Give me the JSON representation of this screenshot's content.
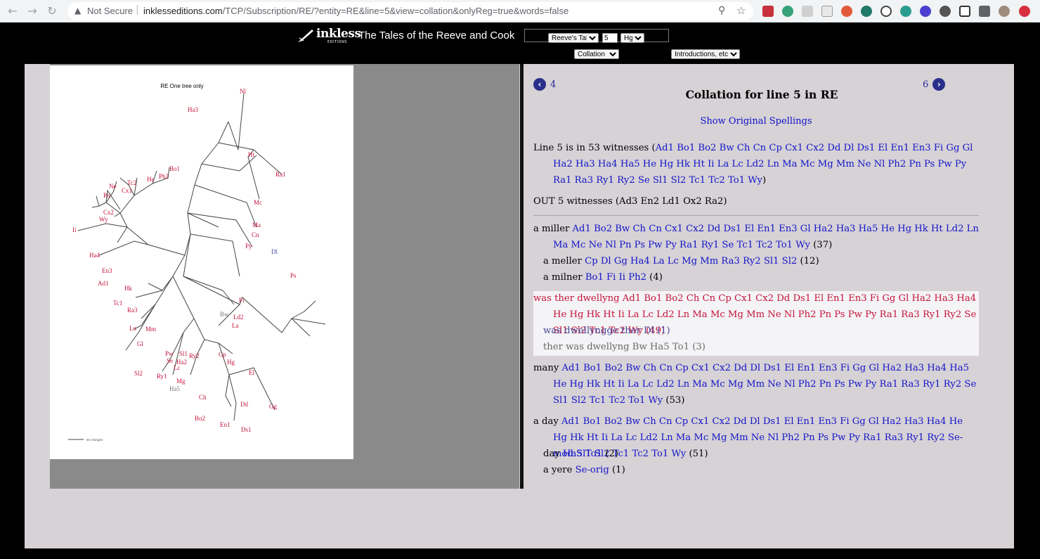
{
  "browser": {
    "not_secure": "Not Secure",
    "url_host": "inklesseditions.com",
    "url_path": "/TCP/Subscription/RE/?entity=RE&line=5&view=collation&onlyReg=true&words=false"
  },
  "header": {
    "logo_text": "inkless",
    "logo_sub": "EDITIONS",
    "title": "The Tales of the Reeve and Cook",
    "tale_select": "Reeve's Tale",
    "line_value": "5",
    "ms_select": "Hg",
    "view_select": "Collation",
    "intro_select": "Introductions, etc"
  },
  "tree": {
    "title": "RE One tree only",
    "scale_label": "50 changes",
    "colors": {
      "red": "#c4143c",
      "blue": "#4a4ab0",
      "grey": "#777777",
      "line": "#444444"
    }
  },
  "collation": {
    "prev_label": "4",
    "next_label": "6",
    "title": "Collation for line 5 in RE",
    "show_original": "Show Original Spellings",
    "in_prefix": "Line 5 is in 53 witnesses (",
    "in_witnesses": "Ad1 Bo1 Bo2 Bw Ch Cn Cp Cx1 Cx2 Dd Dl Ds1 El En1 En3 Fi Gg Gl Ha2 Ha3 Ha4 Ha5 He Hg Hk Ht Ii La Lc Ld2 Ln Ma Mc Mg Mm Ne Nl Ph2 Pn Ps Pw Py Ra1 Ra3 Ry1 Ry2 Se Sl1 Sl2 Tc1 Tc2 To1 Wy",
    "in_suffix": ")",
    "out_text": "OUT 5 witnesses (Ad3 En2 Ld1 Ox2 Ra2)",
    "variants": [
      {
        "reading": "a miller",
        "witnesses": "Ad1 Bo2 Bw Ch Cn Cx1 Cx2 Dd Ds1 El En1 En3 Gl Ha2 Ha3 Ha5 He Hg Hk Ht Ld2 Ln Ma Mc Ne Nl Pn Ps Pw Py Ra1 Ry1 Se Tc1 Tc2 To1 Wy",
        "count": "(37)"
      },
      {
        "reading": "a meller",
        "witnesses": "Cp Dl Gg Ha4 La Lc Mg Mm Ra3 Ry2 Sl1 Sl2",
        "count": "(12)"
      },
      {
        "reading": "a milner",
        "witnesses": "Bo1 Fi Ii Ph2",
        "count": "(4)"
      },
      {
        "reading": "was ther dwellyng",
        "witnesses": "Ad1 Bo1 Bo2 Ch Cn Cp Cx1 Cx2 Dd Ds1 El En1 En3 Fi Gg Gl Ha2 Ha3 Ha4 He Hg Hk Ht Ii La Lc Ld2 Ln Ma Mc Mg Mm Ne Nl Ph2 Pn Ps Pw Py Ra1 Ra3 Ry1 Ry2 Se Sl1 Sl2 Tc1 Tc2 Wy",
        "count": "(49)"
      },
      {
        "reading": "was dwellyngge ther",
        "witnesses": "Dl",
        "count": "(1)"
      },
      {
        "reading": "ther was dwellyng",
        "witnesses": "Bw Ha5 To1",
        "count": "(3)"
      },
      {
        "reading": "many",
        "witnesses": "Ad1 Bo1 Bo2 Bw Ch Cn Cp Cx1 Cx2 Dd Dl Ds1 El En1 En3 Fi Gg Gl Ha2 Ha3 Ha4 Ha5 He Hg Hk Ht Ii La Lc Ld2 Ln Ma Mc Mg Mm Ne Nl Ph2 Pn Ps Pw Py Ra1 Ra3 Ry1 Ry2 Se Sl1 Sl2 Tc1 Tc2 To1 Wy",
        "count": "(53)"
      },
      {
        "reading": "a day",
        "witnesses": "Ad1 Bo1 Bo2 Bw Ch Cn Cp Cx1 Cx2 Dd Dl Ds1 El En1 En3 Fi Gg Gl Ha2 Ha3 Ha4 He Hg Hk Ht Ii La Lc Ld2 Ln Ma Mc Mg Mm Ne Nl Ph2 Pn Ps Pw Py Ra1 Ra3 Ry1 Ry2 Se-mod Sl1 Sl2 Tc1 Tc2 To1 Wy",
        "count": "(51)"
      },
      {
        "reading": "day",
        "witnesses": "Ha5 To1",
        "count": "(2)"
      },
      {
        "reading": "a yere",
        "witnesses": "Se-orig",
        "count": "(1)"
      }
    ]
  }
}
